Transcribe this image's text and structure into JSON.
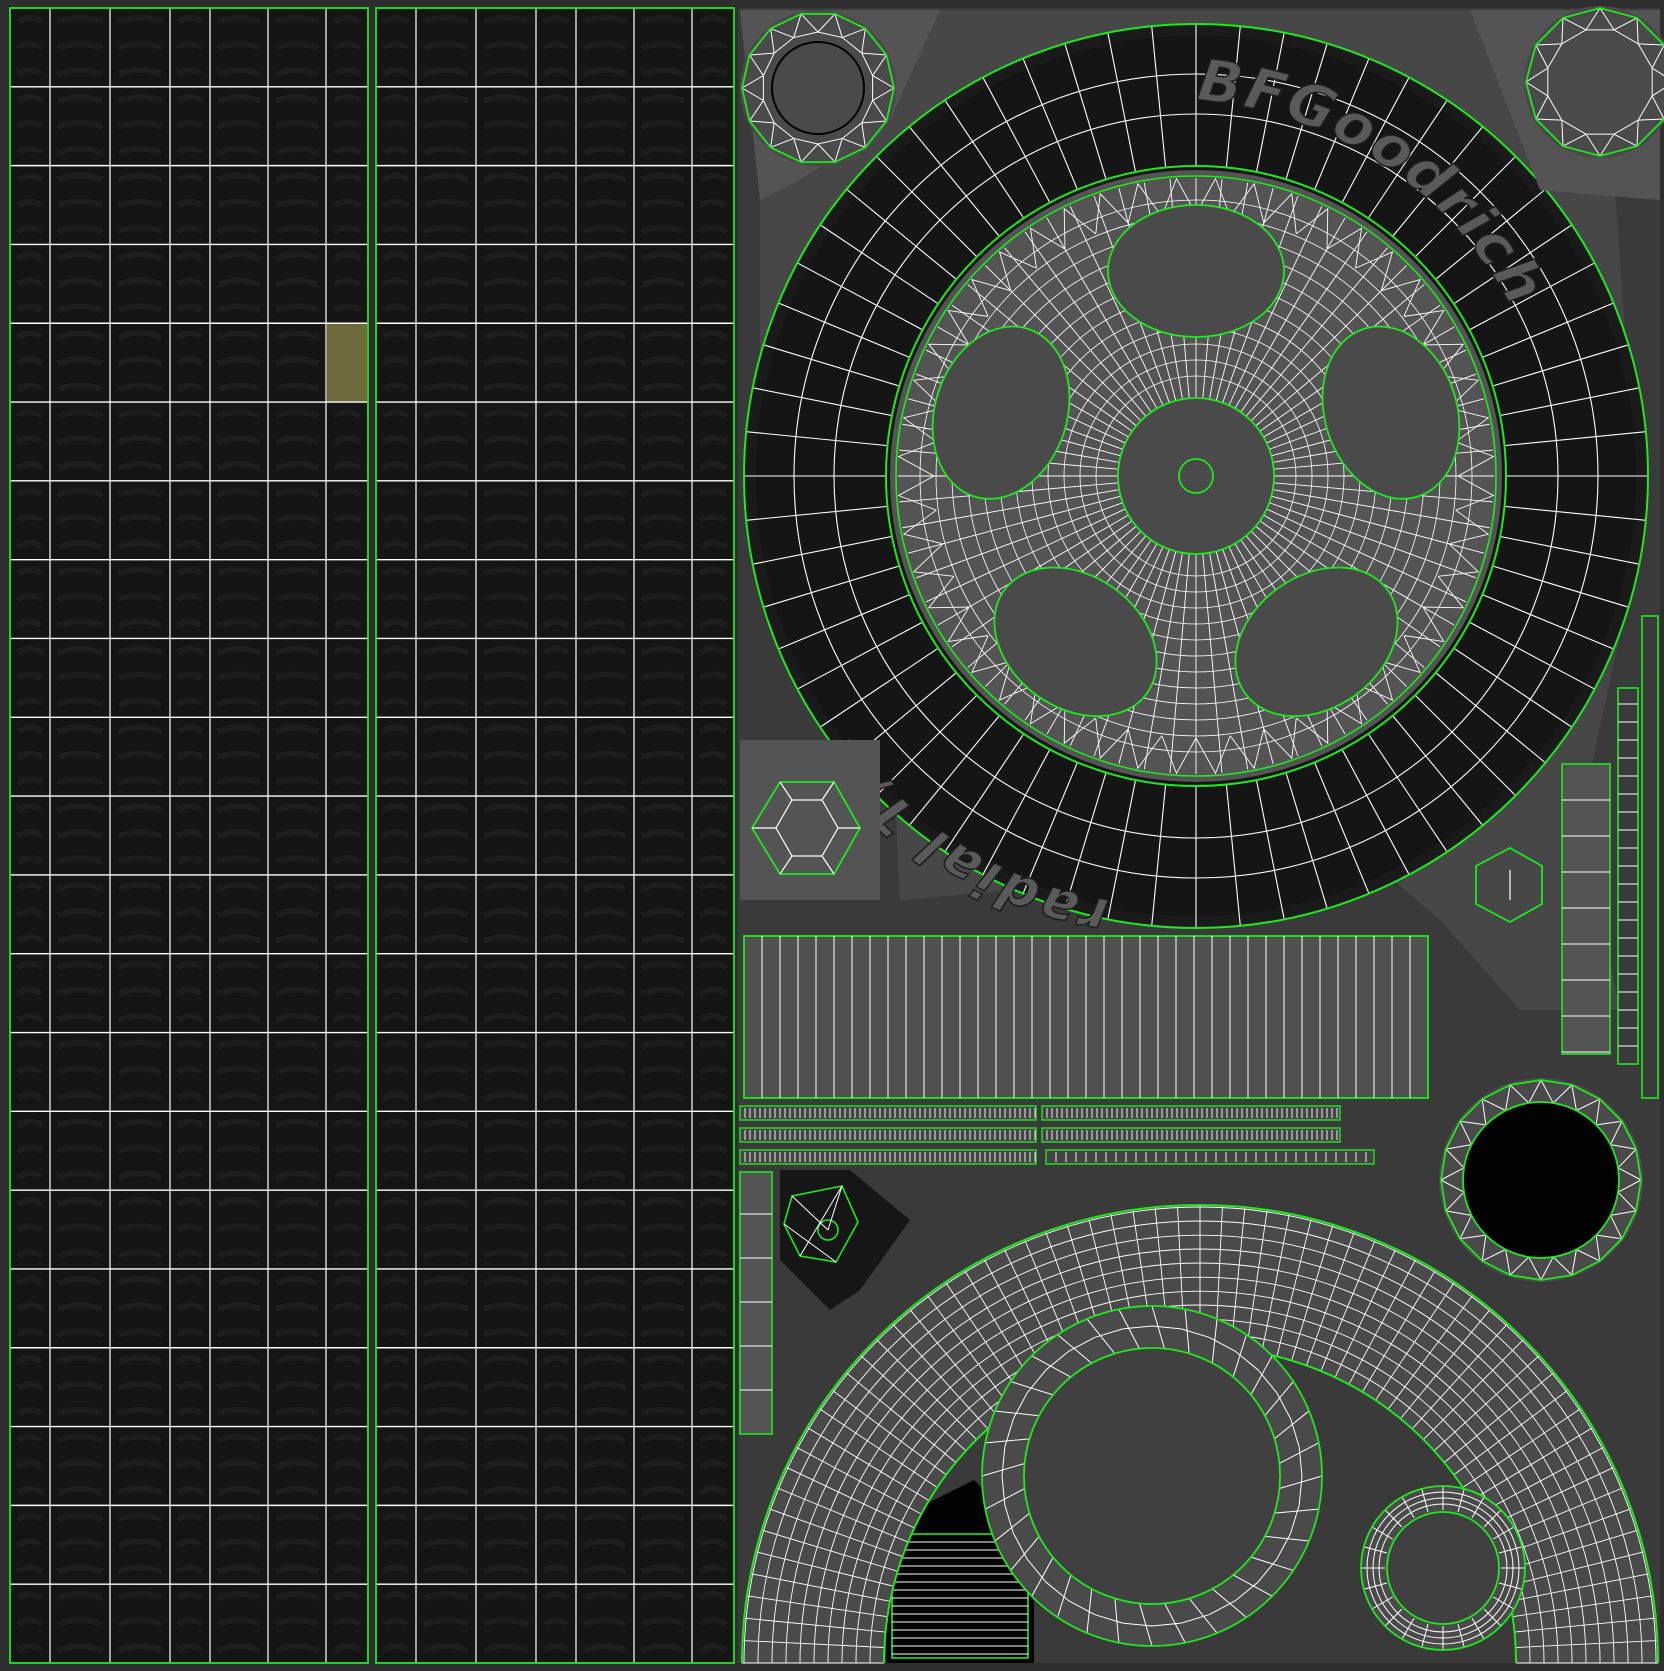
{
  "uv_map": {
    "brand_text": "BFGoodrich",
    "model_text": "radial T/A",
    "colors": {
      "background": "#2e2e2e",
      "tread_fill": "#151515",
      "tread_pattern": "#1d1d1d",
      "island_fill": "#4a4a4a",
      "island_light": "#545454",
      "dark_fill": "#161616",
      "black_fill": "#020202",
      "seam": "#1ee81e",
      "wire": "#ffffff",
      "selected_face": "#6e6a3c",
      "text_fill": "#5a5a5a"
    }
  }
}
